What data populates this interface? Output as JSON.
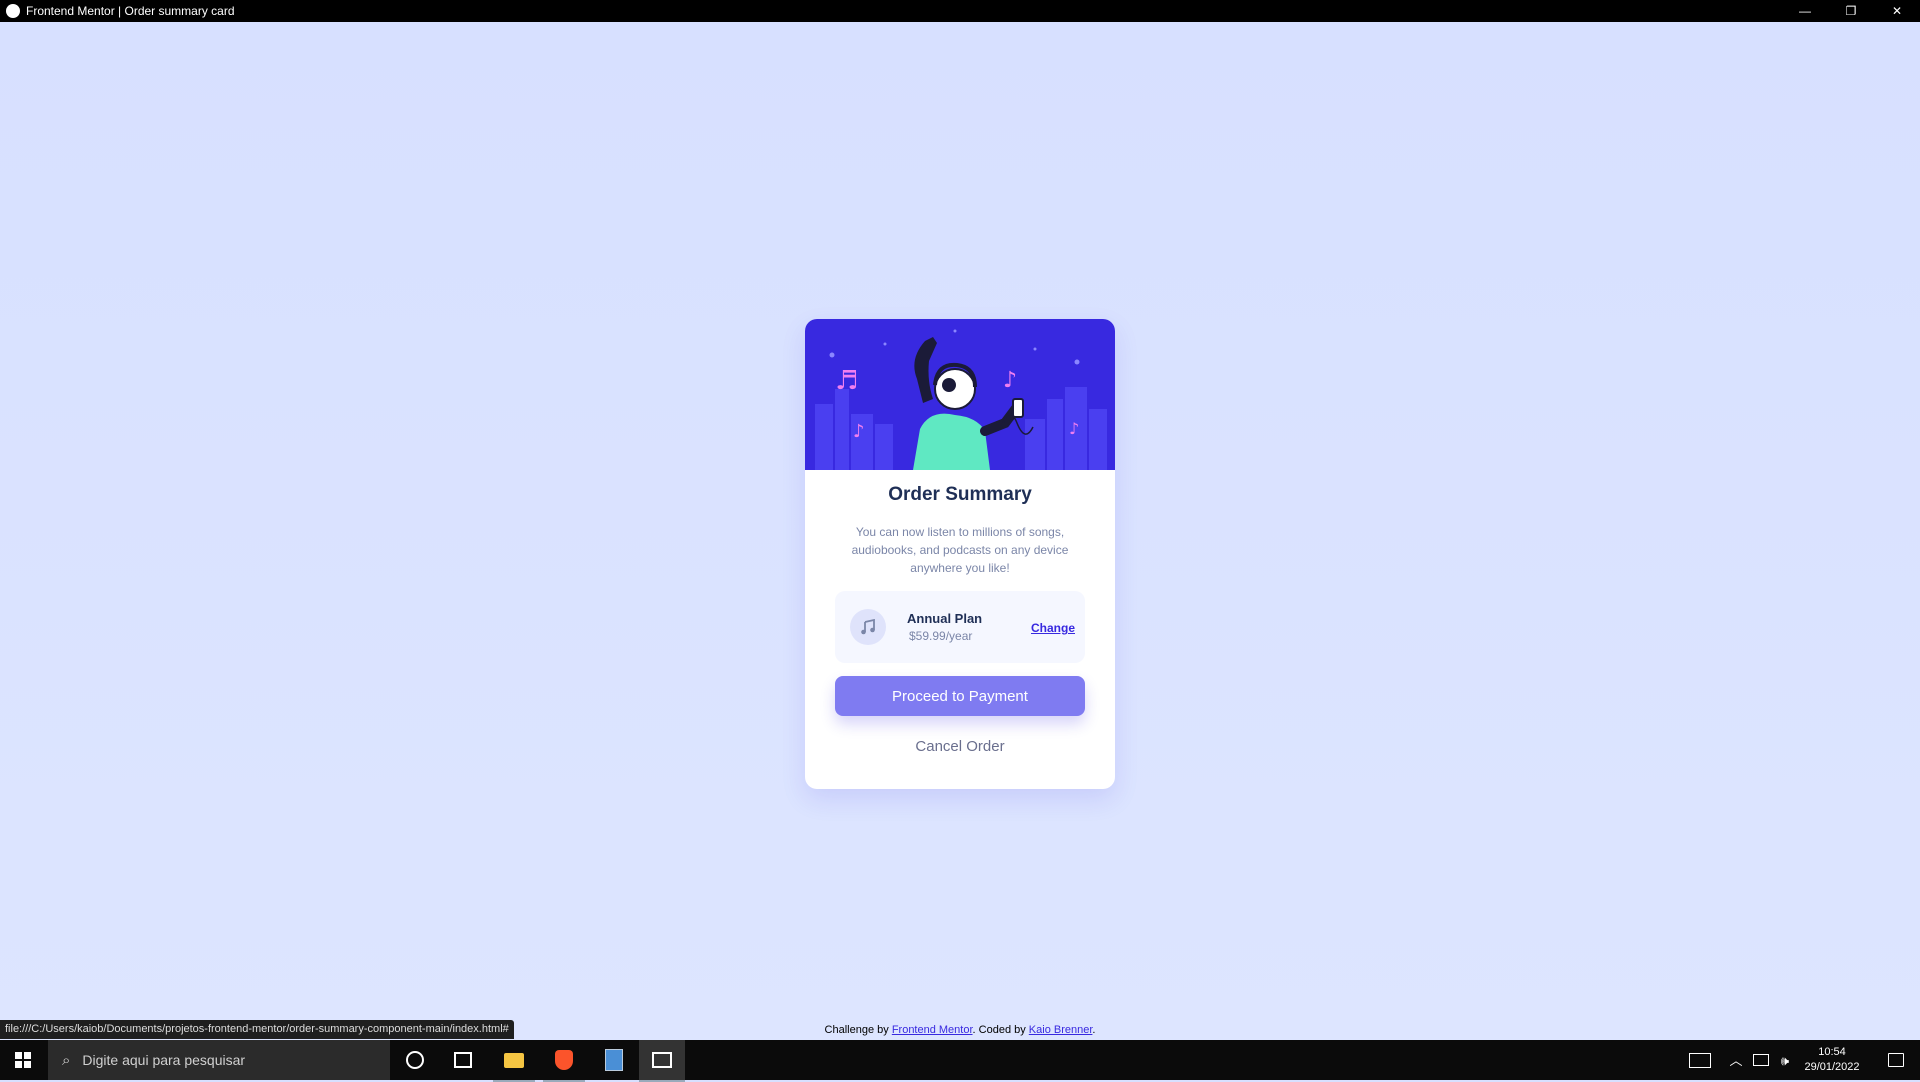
{
  "window": {
    "title": "Frontend Mentor | Order summary card",
    "minimize": "—",
    "restore": "❐",
    "close": "✕"
  },
  "card": {
    "title": "Order Summary",
    "description": "You can now listen to millions of songs, audiobooks, and podcasts on any device anywhere you like!",
    "plan": {
      "name": "Annual Plan",
      "price": "$59.99/year",
      "change_label": "Change",
      "icon": "music-note-icon"
    },
    "pay_label": "Proceed to Payment",
    "cancel_label": "Cancel Order",
    "colors": {
      "hero": "#3829e0",
      "button": "#7f7bf1",
      "title": "#1f2f56"
    }
  },
  "attribution": {
    "prefix": "Challenge by",
    "fm_link": "Frontend Mentor",
    "middle": ". Coded by",
    "author_link": "Kaio Brenner",
    "suffix": "."
  },
  "status_url": "file:///C:/Users/kaiob/Documents/projetos-frontend-mentor/order-summary-component-main/index.html#",
  "taskbar": {
    "search_placeholder": "Digite aqui para pesquisar",
    "time": "10:54",
    "date": "29/01/2022"
  }
}
